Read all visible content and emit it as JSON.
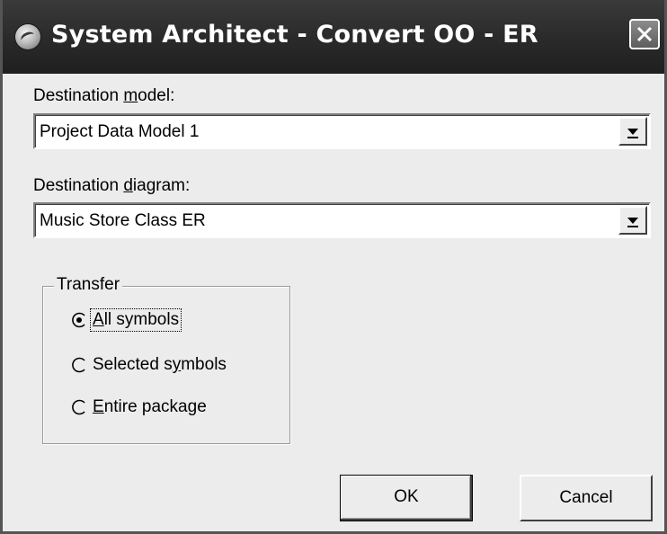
{
  "window": {
    "title": "System Architect - Convert OO - ER"
  },
  "destination_model": {
    "label_pre": "Destination ",
    "label_accel": "m",
    "label_post": "odel:",
    "value": "Project Data Model 1"
  },
  "destination_diagram": {
    "label_pre": "Destination ",
    "label_accel": "d",
    "label_post": "iagram:",
    "value": "Music Store Class ER"
  },
  "transfer": {
    "legend": "Transfer",
    "options": [
      {
        "pre": "",
        "accel": "A",
        "post": "ll symbols",
        "selected": true
      },
      {
        "pre": "Selected s",
        "accel": "y",
        "post": "mbols",
        "selected": false
      },
      {
        "pre": "",
        "accel": "E",
        "post": "ntire package",
        "selected": false
      }
    ]
  },
  "buttons": {
    "ok": "OK",
    "cancel": "Cancel"
  },
  "icons": {
    "app": "system-architect-app-icon",
    "close": "close-icon",
    "dropdown": "chevron-down-icon"
  },
  "colors": {
    "titlebar": "#2b2b2b",
    "dialog_bg": "#ececec"
  }
}
